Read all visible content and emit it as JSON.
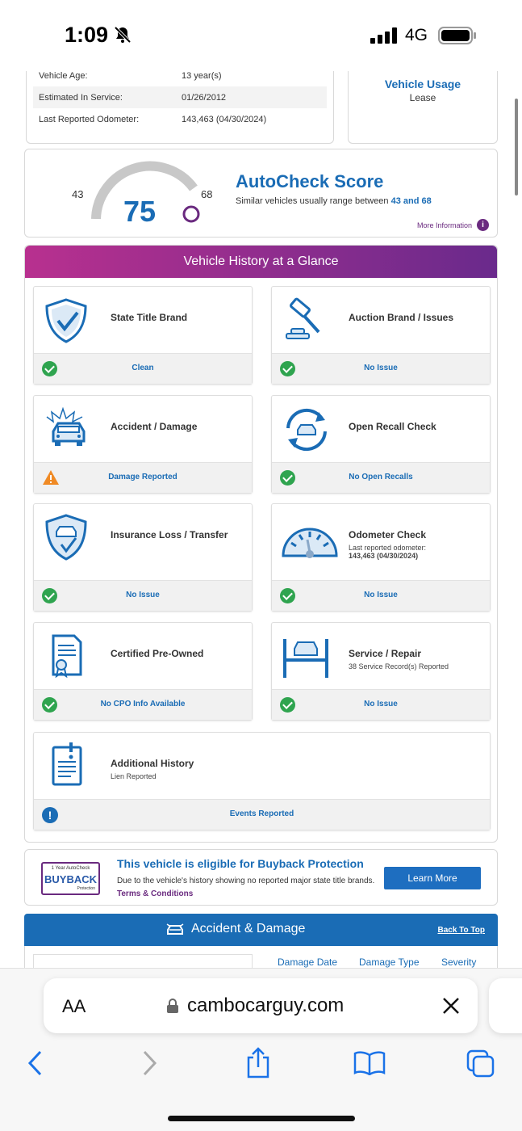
{
  "status_bar": {
    "time": "1:09",
    "network": "4G"
  },
  "vehicle_info": {
    "rows": [
      {
        "label": "Vehicle Age:",
        "value": "13 year(s)"
      },
      {
        "label": "Estimated In Service:",
        "value": "01/26/2012"
      },
      {
        "label": "Last Reported Odometer:",
        "value": "143,463 (04/30/2024)"
      }
    ]
  },
  "usage": {
    "title": "Vehicle Usage",
    "value": "Lease"
  },
  "score": {
    "title": "AutoCheck Score",
    "sub_prefix": "Similar vehicles usually range between",
    "range_text": "43 and 68",
    "min": "43",
    "max": "68",
    "value": "75",
    "more_info": "More Information",
    "info_glyph": "i"
  },
  "glance": {
    "title": "Vehicle History at a Glance",
    "tiles": [
      {
        "title": "State Title Brand",
        "status": "Clean",
        "icon": "shield-check-icon",
        "state": "ok"
      },
      {
        "title": "Auction Brand / Issues",
        "status": "No Issue",
        "icon": "gavel-icon",
        "state": "ok"
      },
      {
        "title": "Accident / Damage",
        "status": "Damage Reported",
        "icon": "car-crash-icon",
        "state": "warn"
      },
      {
        "title": "Open Recall Check",
        "status": "No Open Recalls",
        "icon": "recall-cycle-icon",
        "state": "ok"
      },
      {
        "title": "Insurance Loss / Transfer",
        "status": "No Issue",
        "icon": "car-shield-icon",
        "state": "ok"
      },
      {
        "title": "Odometer Check",
        "sub": "Last reported odometer:",
        "sub2": "143,463 (04/30/2024)",
        "status": "No Issue",
        "icon": "odometer-icon",
        "state": "ok"
      },
      {
        "title": "Certified Pre-Owned",
        "status": "No CPO Info Available",
        "icon": "certificate-icon",
        "state": "ok"
      },
      {
        "title": "Service / Repair",
        "sub": "38 Service Record(s) Reported",
        "status": "No Issue",
        "icon": "car-lift-icon",
        "state": "ok"
      },
      {
        "title": "Additional History",
        "sub": "Lien Reported",
        "status": "Events Reported",
        "icon": "document-alert-icon",
        "state": "info"
      }
    ],
    "info_glyph": "!"
  },
  "buyback": {
    "logo_small": "1 Year AutoCheck",
    "logo_big": "BUYBACK",
    "logo_prot": "Protection",
    "title": "This vehicle is eligible for Buyback Protection",
    "text": "Due to the vehicle's history showing no reported major state title brands.",
    "link": "Terms & Conditions",
    "button": "Learn More"
  },
  "accident": {
    "title": "Accident & Damage",
    "back_to_top": "Back To Top",
    "columns": [
      "Damage Date",
      "Damage Type",
      "Severity"
    ]
  },
  "browser": {
    "aa": "AA",
    "url": "cambocarguy.com"
  },
  "colors": {
    "brand_blue": "#1a6cb5",
    "purple": "#6a2a7f",
    "ok_green": "#2fa44f",
    "warn_orange": "#f08a24"
  }
}
